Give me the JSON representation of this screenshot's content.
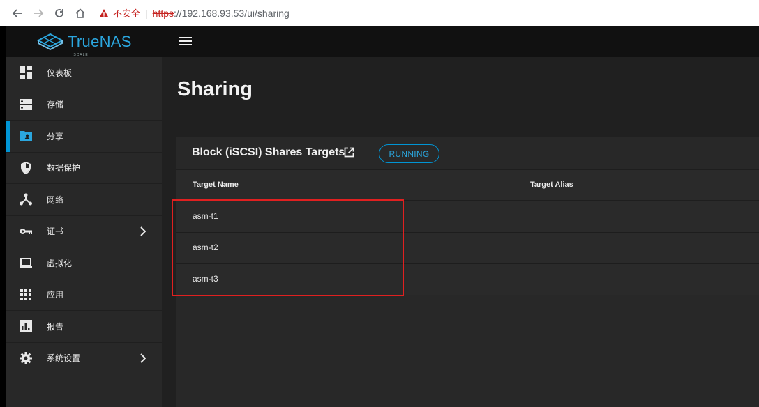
{
  "browser": {
    "insecure_label": "不安全",
    "separator": "|",
    "url_protocol": "https",
    "url_rest": "://192.168.93.53/ui/sharing"
  },
  "app": {
    "logo_text": "TrueNAS",
    "logo_sub": "SCALE"
  },
  "sidebar": {
    "items": [
      {
        "label": "仪表板",
        "icon": "dashboard-icon",
        "active": false,
        "has_chevron": false
      },
      {
        "label": "存储",
        "icon": "storage-icon",
        "active": false,
        "has_chevron": false
      },
      {
        "label": "分享",
        "icon": "folder-shared-icon",
        "active": true,
        "has_chevron": false
      },
      {
        "label": "数据保护",
        "icon": "shield-icon",
        "active": false,
        "has_chevron": false
      },
      {
        "label": "网络",
        "icon": "network-icon",
        "active": false,
        "has_chevron": false
      },
      {
        "label": "证书",
        "icon": "key-icon",
        "active": false,
        "has_chevron": true
      },
      {
        "label": "虚拟化",
        "icon": "laptop-icon",
        "active": false,
        "has_chevron": false
      },
      {
        "label": "应用",
        "icon": "apps-grid-icon",
        "active": false,
        "has_chevron": false
      },
      {
        "label": "报告",
        "icon": "report-chart-icon",
        "active": false,
        "has_chevron": false
      },
      {
        "label": "系统设置",
        "icon": "gear-icon",
        "active": false,
        "has_chevron": true
      }
    ]
  },
  "main": {
    "page_title": "Sharing",
    "card": {
      "title": "Block (iSCSI) Shares Targets",
      "status": "RUNNING",
      "columns": [
        "Target Name",
        "Target Alias"
      ],
      "rows": [
        {
          "name": "asm-t1",
          "alias": ""
        },
        {
          "name": "asm-t2",
          "alias": ""
        },
        {
          "name": "asm-t3",
          "alias": ""
        }
      ]
    }
  },
  "colors": {
    "accent": "#0095d5",
    "highlight_box": "#e02020"
  }
}
